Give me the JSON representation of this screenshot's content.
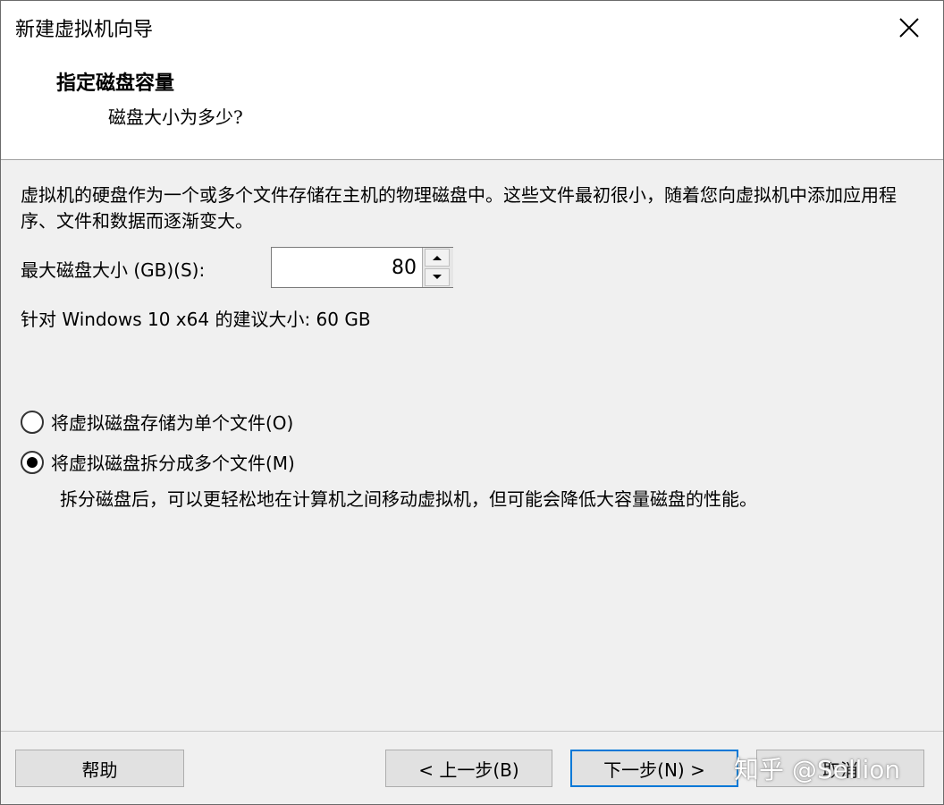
{
  "window": {
    "title": "新建虚拟机向导"
  },
  "header": {
    "step_title": "指定磁盘容量",
    "step_subtitle": "磁盘大小为多少?"
  },
  "description": "虚拟机的硬盘作为一个或多个文件存储在主机的物理磁盘中。这些文件最初很小，随着您向虚拟机中添加应用程序、文件和数据而逐渐变大。",
  "disk_size": {
    "label": "最大磁盘大小 (GB)(S):",
    "value": "80"
  },
  "recommended": "针对 Windows 10 x64 的建议大小: 60 GB",
  "options": {
    "single": {
      "label": "将虚拟磁盘存储为单个文件(O)",
      "checked": false
    },
    "split": {
      "label": "将虚拟磁盘拆分成多个文件(M)",
      "checked": true
    },
    "split_description": "拆分磁盘后，可以更轻松地在计算机之间移动虚拟机，但可能会降低大容量磁盘的性能。"
  },
  "buttons": {
    "help": "帮助",
    "back": "< 上一步(B)",
    "next": "下一步(N) >",
    "cancel": "取消"
  },
  "watermark": "知乎 @Sellion",
  "icons": {
    "close": "close-icon",
    "spin_up": "arrow-up-icon",
    "spin_down": "arrow-down-icon"
  },
  "colors": {
    "default_button_border": "#0078d7"
  }
}
